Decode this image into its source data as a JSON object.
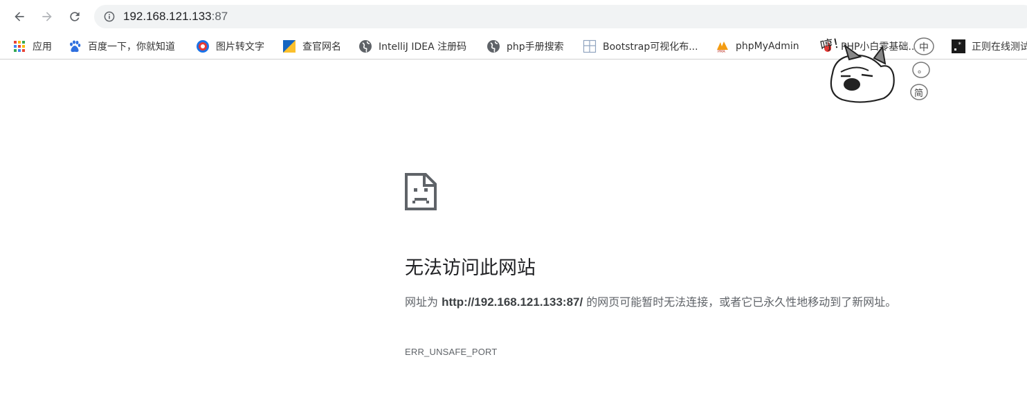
{
  "toolbar": {
    "url_host": "192.168.121.133",
    "url_port": ":87"
  },
  "bookmarks": [
    {
      "label": "应用",
      "icon": "apps-grid-icon"
    },
    {
      "label": "百度一下，你就知道",
      "icon": "baidu-paw-icon"
    },
    {
      "label": "图片转文字",
      "icon": "image-ocr-icon"
    },
    {
      "label": "查官网名",
      "icon": "site-lookup-icon"
    },
    {
      "label": "IntelliJ IDEA 注册码",
      "icon": "globe-icon"
    },
    {
      "label": "php手册搜索",
      "icon": "globe-icon"
    },
    {
      "label": "Bootstrap可视化布...",
      "icon": "layout-grid-icon"
    },
    {
      "label": "phpMyAdmin",
      "icon": "phpmyadmin-icon"
    },
    {
      "label": "PHP小白零基础...",
      "icon": "flame-icon"
    },
    {
      "label": "正则在线测试",
      "icon": "regex-icon"
    }
  ],
  "error": {
    "title": "无法访问此网站",
    "desc_prefix": "网址为 ",
    "desc_url": "http://192.168.121.133:87/",
    "desc_suffix": " 的网页可能暂时无法连接，或者它已永久性地移动到了新网址。",
    "code": "ERR_UNSAFE_PORT"
  },
  "sticker": {
    "hand_text": "哼!",
    "bubbles": [
      "中",
      "。",
      "简"
    ]
  },
  "colors": {
    "omnibox_bg": "#f1f3f4",
    "title_text": "#202124",
    "body_text": "#5f6368"
  }
}
